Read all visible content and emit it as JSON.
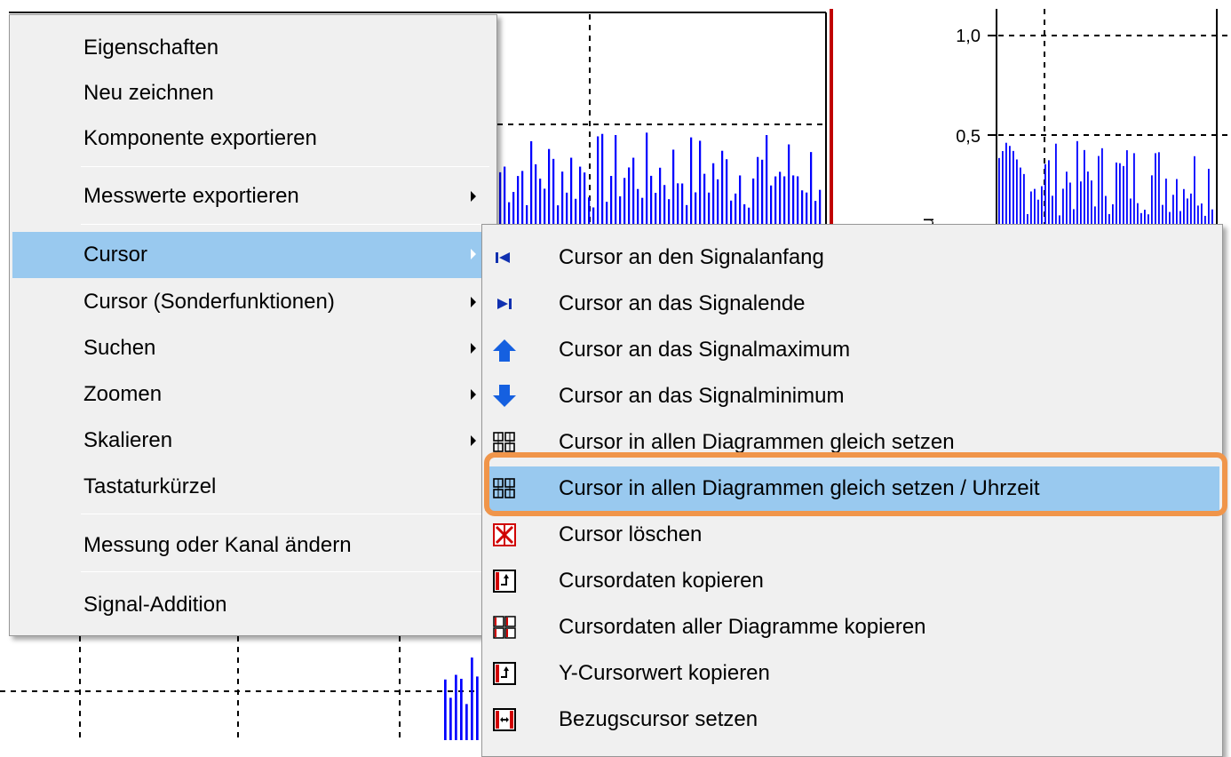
{
  "background_charts": {
    "left_chart": {},
    "right_chart": {
      "y_tick_labels": [
        "1,0",
        "0,5"
      ],
      "y_axis_label_fragment": "m/s"
    }
  },
  "context_menu": {
    "items": [
      {
        "label": "Eigenschaften"
      },
      {
        "label": "Neu zeichnen"
      },
      {
        "label": "Komponente exportieren"
      },
      {
        "label": "Messwerte exportieren",
        "submenu": true
      },
      {
        "label": "Cursor",
        "submenu": true,
        "highlighted": true
      },
      {
        "label": "Cursor (Sonderfunktionen)",
        "submenu": true
      },
      {
        "label": "Suchen",
        "submenu": true
      },
      {
        "label": "Zoomen",
        "submenu": true
      },
      {
        "label": "Skalieren",
        "submenu": true
      },
      {
        "label": "Tastaturkürzel"
      },
      {
        "label": "Messung oder Kanal ändern"
      },
      {
        "label": "Signal-Addition"
      }
    ]
  },
  "cursor_submenu": {
    "items": [
      {
        "label": "Cursor an den Signalanfang",
        "icon": "cursor-to-start-icon"
      },
      {
        "label": "Cursor an das Signalende",
        "icon": "cursor-to-end-icon"
      },
      {
        "label": "Cursor an das Signalmaximum",
        "icon": "arrow-up-icon"
      },
      {
        "label": "Cursor an das Signalminimum",
        "icon": "arrow-down-icon"
      },
      {
        "label": "Cursor in allen Diagrammen gleich setzen",
        "icon": "grid-sync-icon"
      },
      {
        "label": "Cursor in allen Diagrammen gleich setzen / Uhrzeit",
        "icon": "grid-sync-icon",
        "highlighted": true
      },
      {
        "label": "Cursor löschen",
        "icon": "cursor-delete-icon"
      },
      {
        "label": "Cursordaten kopieren",
        "icon": "copy-cursor-data-icon"
      },
      {
        "label": "Cursordaten aller Diagramme kopieren",
        "icon": "copy-all-cursor-data-icon"
      },
      {
        "label": "Y-Cursorwert kopieren",
        "icon": "copy-y-value-icon"
      },
      {
        "label": "Bezugscursor setzen",
        "icon": "reference-cursor-icon"
      }
    ]
  },
  "colors": {
    "highlight": "#99c9ef",
    "callout": "#f0954a",
    "signal": "#0000ff",
    "menu_background": "#f0f0f0"
  }
}
